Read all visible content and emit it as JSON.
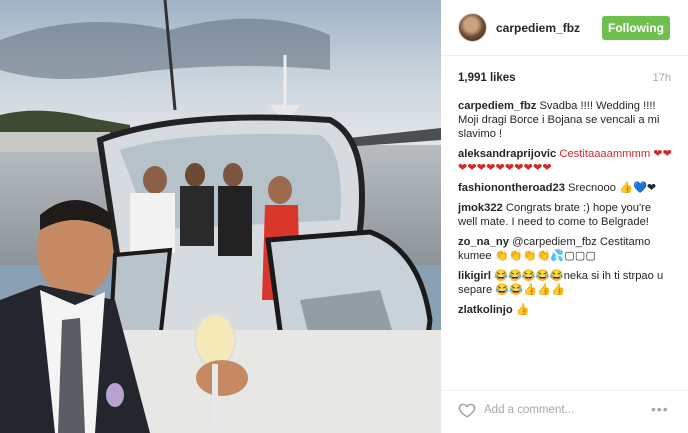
{
  "post": {
    "username": "carpediem_fbz",
    "follow_label": "Following",
    "likes": "1,991 likes",
    "time": "17h",
    "comments": [
      {
        "user": "carpediem_fbz",
        "text": "Svadba !!!! Wedding !!!! Moji dragi Borce i Bojana se vencali a mi slavimo !"
      },
      {
        "user": "aleksandraprijovic",
        "text": "Cestitaaaammmm ❤❤❤❤❤❤❤❤❤❤❤❤"
      },
      {
        "user": "fashionontheroad23",
        "text": "Srecnooo 👍💙❤"
      },
      {
        "user": "jmok322",
        "text": "Congrats brate :) hope you're well mate. I need to come to Belgrade!"
      },
      {
        "user": "zo_na_ny",
        "text": "@carpediem_fbz Cestitamo kumee 👏👏👏👏💦▢▢▢"
      },
      {
        "user": "likigirl",
        "text": "😂😂😂😂😂neka si ih ti strpao u separe 😂😂👍👍👍"
      },
      {
        "user": "zlatkolinjo",
        "text": "👍"
      }
    ],
    "add_comment_placeholder": "Add a comment...",
    "more_label": "•••"
  }
}
